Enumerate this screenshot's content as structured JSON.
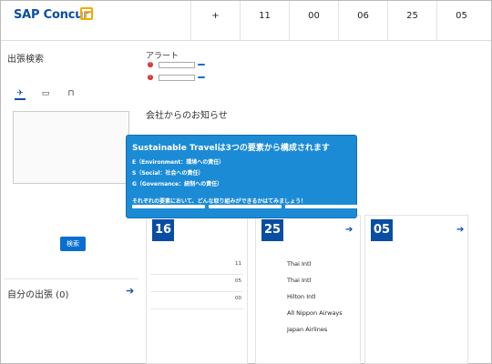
{
  "header": {
    "logo_text": "SAP Concur",
    "stats": [
      {
        "num": "+",
        "label": ""
      },
      {
        "num": "11",
        "label": ""
      },
      {
        "num": "00",
        "label": ""
      },
      {
        "num": "06",
        "label": ""
      },
      {
        "num": "25",
        "label": ""
      },
      {
        "num": "05",
        "label": ""
      }
    ]
  },
  "trip_search": {
    "title": "出張検索",
    "tab_1": "",
    "tab_2": "",
    "button": "検索",
    "footer": ""
  },
  "my_trips": {
    "title": "自分の出張 (0)",
    "body": ""
  },
  "alerts": {
    "title": "アラート",
    "row_1": "",
    "row_2": "",
    "button_1": "",
    "button_2": ""
  },
  "news": {
    "title": "会社からのお知らせ",
    "link": ""
  },
  "popup": {
    "title": "Sustainable Travelは3つの要素から構成されます",
    "line_e": "E（Environment：環境への責任）",
    "line_s": "S（Social：社会への責任）",
    "line_g": "G（Governance：統制への責任）",
    "question": "それぞれの要素において、どんな取り組みができるかはてみましょう！",
    "btn_1": "",
    "btn_2": "",
    "btn_3": ""
  },
  "card_approvals": {
    "num": "16",
    "head": "",
    "sub": "",
    "rows": [
      {
        "label": "",
        "value": "11"
      },
      {
        "label": "",
        "value": "05"
      },
      {
        "label": "",
        "value": "00"
      }
    ]
  },
  "card_reports": {
    "num": "25",
    "head": "",
    "sub": "",
    "rows": [
      {
        "date": "",
        "name": "Thai Intl",
        "amount": ""
      },
      {
        "date": "",
        "name": "Thai Intl",
        "amount": ""
      },
      {
        "date": "",
        "name": "Hilton Intl",
        "amount": ""
      },
      {
        "date": "",
        "name": "All Nippon Airways",
        "amount": ""
      },
      {
        "date": "",
        "name": "Japan Airlines",
        "amount": ""
      }
    ]
  },
  "card_expenses": {
    "num": "05",
    "head": "",
    "sub": "",
    "rows": [
      {
        "date": "",
        "name": "",
        "amount": ""
      },
      {
        "date": "",
        "name": "",
        "amount": ""
      },
      {
        "date": "",
        "name": "",
        "amount": ""
      },
      {
        "date": "",
        "name": "",
        "amount": ""
      },
      {
        "date": "",
        "name": "",
        "amount": ""
      }
    ]
  }
}
